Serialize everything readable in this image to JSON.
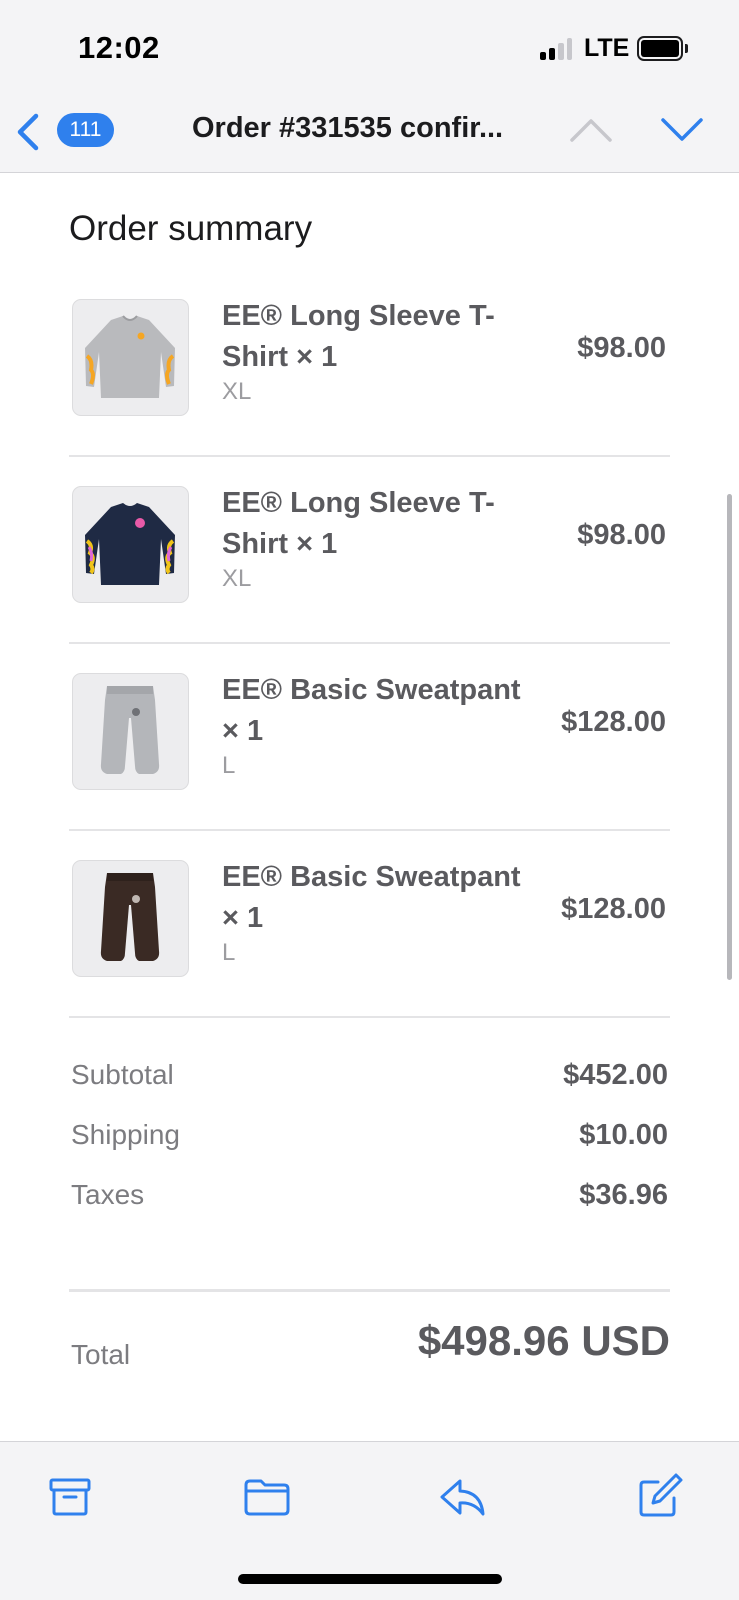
{
  "status_bar": {
    "time": "12:02",
    "network": "LTE",
    "icons": [
      "cellular-signal-icon",
      "battery-icon"
    ]
  },
  "nav": {
    "back_icon": "chevron-left-icon",
    "unread_count": "111",
    "title": "Order #331535 confir...",
    "prev_icon": "chevron-up-icon",
    "next_icon": "chevron-down-icon",
    "accent_color": "#2f80ed"
  },
  "summary": {
    "title": "Order summary",
    "items": [
      {
        "name": "EE® Long Sleeve T-Shirt × 1",
        "variant": "XL",
        "price": "$98.00",
        "thumbnail_icon": "grey-long-sleeve-shirt-icon"
      },
      {
        "name": "EE® Long Sleeve T-Shirt × 1",
        "variant": "XL",
        "price": "$98.00",
        "thumbnail_icon": "navy-long-sleeve-shirt-icon"
      },
      {
        "name": "EE® Basic Sweatpant × 1",
        "variant": "L",
        "price": "$128.00",
        "thumbnail_icon": "grey-sweatpant-icon"
      },
      {
        "name": "EE® Basic Sweatpant × 1",
        "variant": "L",
        "price": "$128.00",
        "thumbnail_icon": "brown-sweatpant-icon"
      }
    ],
    "totals": [
      {
        "label": "Subtotal",
        "value": "$452.00"
      },
      {
        "label": "Shipping",
        "value": "$10.00"
      },
      {
        "label": "Taxes",
        "value": "$36.96"
      }
    ],
    "total": {
      "label": "Total",
      "value": "$498.96 USD"
    }
  },
  "toolbar": {
    "icons": [
      "archive-icon",
      "folder-icon",
      "reply-icon",
      "compose-icon"
    ]
  }
}
